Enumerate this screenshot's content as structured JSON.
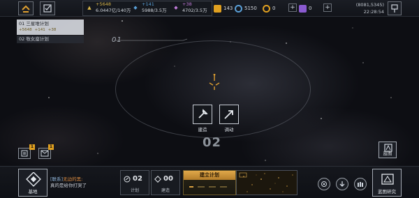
{
  "top": {
    "resources": [
      {
        "gain": "+5648",
        "amount": "6.0447亿/140万",
        "color": "#d9b64a",
        "icon": "energy-icon"
      },
      {
        "gain": "+141",
        "amount": "5988/3.5万",
        "color": "#5aa0d8",
        "icon": "metal-icon"
      },
      {
        "gain": "+38",
        "amount": "4702/3.5万",
        "color": "#c07ad8",
        "icon": "crystal-icon"
      }
    ],
    "fuel": "143",
    "coin": "5150",
    "token_a": "0",
    "token_b": "0",
    "coords": "(8081,5345)",
    "time": "22:28:54"
  },
  "plans": {
    "plan1": {
      "title": "01 三星堆计划",
      "gain_energy": "+5648",
      "gain_metal": "+141",
      "gain_crystal": "+38"
    },
    "plan2": {
      "title": "02 牧女座计划"
    }
  },
  "map": {
    "label_01": "01",
    "label_02": "02",
    "build_label": "建造",
    "dispatch_label": "调动"
  },
  "side": {
    "mail_badge": "1",
    "tasks_badge": "1",
    "blueprint_label": "蓝图"
  },
  "bottom": {
    "base_label": "基地",
    "message_tag": "[联系]",
    "message_sender": "无边的黑:",
    "message_text": "真的是给你打哭了",
    "plan_count": "02",
    "plan_label": "计划",
    "build_count": "00",
    "build_label": "建造",
    "build_plan_header": "建立计划",
    "research_label": "蓝图研究"
  }
}
